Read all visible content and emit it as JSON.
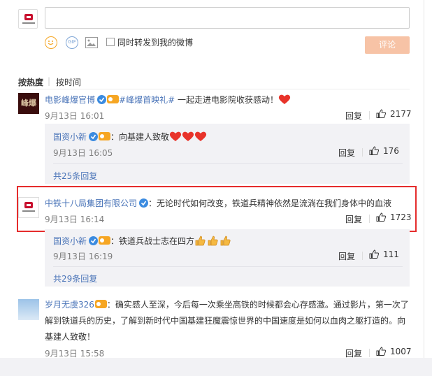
{
  "compose": {
    "input_value": "",
    "forward_label": "同时转发到我的微博",
    "submit_label": "评论",
    "gif_label": "GIF"
  },
  "sort": {
    "hot_label": "按热度",
    "separator": "|",
    "time_label": "按时间"
  },
  "comments": [
    {
      "name": "电影峰爆官博",
      "text_tag": "#峰爆首映礼#",
      "text": " 一起走进电影院收获感动！",
      "time": "9月13日 16:01",
      "reply_label": "回复",
      "likes": "2177",
      "avatar_text": "峰爆",
      "replies": [
        {
          "name": "国资小新",
          "text": "：向基建人致敬",
          "time": "9月13日 16:05",
          "reply_label": "回复",
          "likes": "176"
        }
      ],
      "more_label": "共25条回复"
    },
    {
      "name": "中铁十八局集团有限公司",
      "text": "：无论时代如何改变，铁道兵精神依然是流淌在我们身体中的血液",
      "time": "9月13日 16:14",
      "reply_label": "回复",
      "likes": "1723",
      "replies": [
        {
          "name": "国资小新",
          "text": "：铁道兵战士志在四方",
          "time": "9月13日 16:19",
          "reply_label": "回复",
          "likes": "111"
        }
      ],
      "more_label": "共29条回复"
    },
    {
      "name": "岁月无虞326",
      "text": "：确实感人至深，今后每一次乘坐高铁的时候都会心存感激。通过影片，第一次了解到铁道兵的历史，了解到新时代中国基建狂魔震惊世界的中国速度是如何以血肉之躯打造的。向基建人致敬！",
      "time": "9月13日 15:58",
      "reply_label": "回复",
      "likes": "1007"
    }
  ],
  "colors": {
    "link_blue": "#4a74b8",
    "highlight_red": "#e52c2c",
    "button_orange": "#f7c3a6",
    "heart_red": "#e8332a"
  }
}
